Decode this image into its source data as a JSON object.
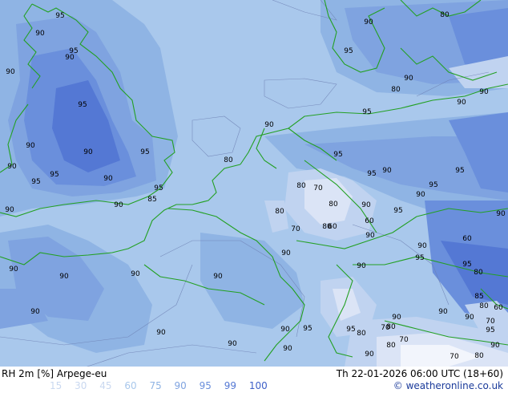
{
  "product": {
    "title": "RH 2m [%] Arpege-eu",
    "valid_time": "Th 22-01-2026 06:00 UTC (18+60)",
    "credit": "© weatheronline.co.uk"
  },
  "legend": {
    "values": [
      "15",
      "30",
      "45",
      "60",
      "75",
      "90",
      "95",
      "99",
      "100"
    ],
    "colors": [
      "#f2f5fc",
      "#dbe4f6",
      "#c0d3f0",
      "#a9c8ec",
      "#8fb4e4",
      "#7fa3e0",
      "#6a8fdc",
      "#5478d4",
      "#3d5fc8"
    ]
  },
  "map_labels": [
    "95",
    "90",
    "95",
    "90",
    "90",
    "95",
    "95",
    "90",
    "95",
    "90",
    "95",
    "90",
    "90",
    "95",
    "85",
    "90",
    "90",
    "90",
    "90",
    "90",
    "90",
    "90",
    "90",
    "90",
    "90",
    "90",
    "80",
    "90",
    "95",
    "95",
    "90",
    "95",
    "95",
    "90",
    "95",
    "90",
    "95",
    "90",
    "90",
    "80",
    "70",
    "80",
    "60",
    "90",
    "80",
    "70",
    "80",
    "60",
    "90",
    "95",
    "90",
    "95",
    "90",
    "80",
    "90",
    "90",
    "80",
    "90",
    "90",
    "80",
    "95",
    "95",
    "90",
    "80",
    "80",
    "95",
    "70",
    "90",
    "80",
    "70",
    "70",
    "80",
    "95",
    "90",
    "85",
    "80",
    "60",
    "70",
    "90",
    "60"
  ]
}
